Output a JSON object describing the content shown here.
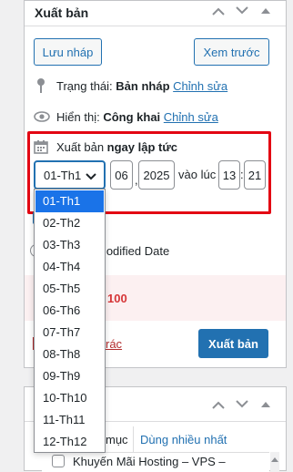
{
  "publish_panel": {
    "title": "Xuất bản",
    "save_draft": "Lưu nháp",
    "preview": "Xem trước",
    "status_label": "Trạng thái:",
    "status_value": "Bản nháp",
    "status_edit": "Chỉnh sửa",
    "visibility_label": "Hiển thị:",
    "visibility_value": "Công khai",
    "visibility_edit": "Chỉnh sửa",
    "publish_label": "Xuất bản",
    "publish_value": "ngay lập tức",
    "month_selected": "01-Th1",
    "day": "06",
    "year": "2025",
    "at_label": "vào lúc",
    "hour": "13",
    "minute": "21",
    "modified_date": "Modified Date",
    "score_fragment": "100",
    "trash_fragment": "rác",
    "publish_button": "Xuất bản"
  },
  "month_options": [
    "01-Th1",
    "02-Th2",
    "03-Th3",
    "04-Th4",
    "05-Th5",
    "06-Th6",
    "07-Th7",
    "08-Th8",
    "09-Th9",
    "10-Th10",
    "11-Th11",
    "12-Th12"
  ],
  "categories_panel": {
    "tab_all_fragment": "mục",
    "tab_most_used": "Dùng nhiều nhất",
    "first_item": "Khuyến Mãi Hosting – VPS –"
  },
  "colors": {
    "accent": "#2271b1",
    "highlight_box": "#e30613",
    "selected_option": "#1a73e8",
    "danger": "#d63638"
  }
}
